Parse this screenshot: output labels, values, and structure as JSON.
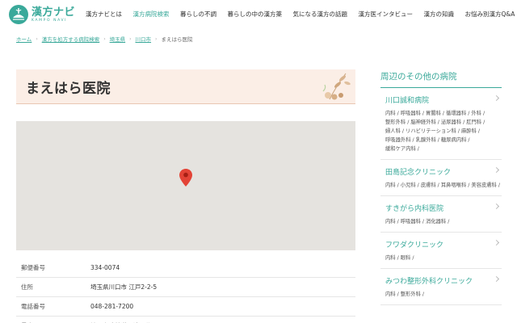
{
  "header": {
    "logo": {
      "title": "漢方ナビ",
      "subtitle": "KAMPO NAVI"
    },
    "nav": [
      {
        "label": "漢方ナビとは",
        "active": false
      },
      {
        "label": "漢方病院検索",
        "active": true
      },
      {
        "label": "暮らしの不調",
        "active": false
      },
      {
        "label": "暮らしの中の漢方薬",
        "active": false
      },
      {
        "label": "気になる漢方の話題",
        "active": false
      },
      {
        "label": "漢方医インタビュー",
        "active": false
      },
      {
        "label": "漢方の知識",
        "active": false
      },
      {
        "label": "お悩み別漢方Q&A",
        "active": false
      }
    ]
  },
  "breadcrumb": {
    "items": [
      "ホーム",
      "漢方を処方する病院検索",
      "埼玉県",
      "川口市"
    ],
    "current": "まえはら医院",
    "separator": "›"
  },
  "page": {
    "title": "まえはら医院"
  },
  "info": [
    {
      "label": "郵便番号",
      "value": "334-0074"
    },
    {
      "label": "住所",
      "value": "埼玉県川口市 江戸2-2-5"
    },
    {
      "label": "電話番号",
      "value": "048-281-7200"
    },
    {
      "label": "最寄駅",
      "value": "埼玉高速鉄道　鳩ヶ谷"
    }
  ],
  "sidebar": {
    "title": "周辺のその他の病院",
    "hospitals": [
      {
        "name": "川口誠和病院",
        "tags": [
          "内科",
          "呼吸器科",
          "胃腸科",
          "循環器科",
          "外科",
          "整形外科",
          "脳神経外科",
          "泌尿器科",
          "肛門科",
          "婦人科",
          "リハビリテーション科",
          "麻酔科",
          "呼吸器外科",
          "乳腺外科",
          "糖尿病内科",
          "緩和ケア内科"
        ]
      },
      {
        "name": "田島記念クリニック",
        "tags": [
          "内科",
          "小児科",
          "皮膚科",
          "耳鼻咽喉科",
          "美容皮膚科"
        ]
      },
      {
        "name": "すきがら内科医院",
        "tags": [
          "内科",
          "呼吸器科",
          "消化器科"
        ]
      },
      {
        "name": "フワダクリニック",
        "tags": [
          "内科",
          "眼科"
        ]
      },
      {
        "name": "みつわ整形外科クリニック",
        "tags": [
          "内科",
          "整形外科"
        ]
      }
    ]
  },
  "colors": {
    "accent": "#3aa99a",
    "title_bg": "#fbeee6",
    "map_bg": "#e5e3df",
    "pin": "#e34336"
  }
}
